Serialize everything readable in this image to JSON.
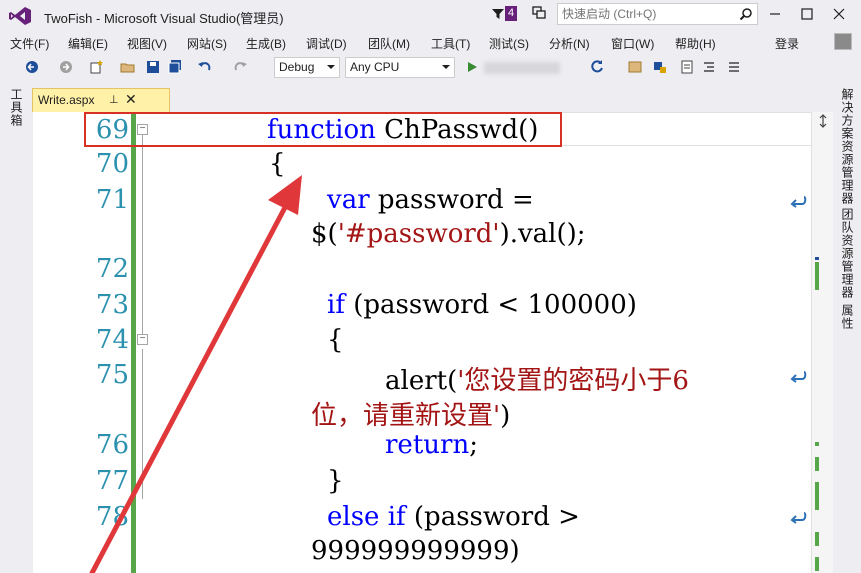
{
  "window": {
    "title": "TwoFish - Microsoft Visual Studio(管理员)",
    "notification_count": "4",
    "quick_launch_placeholder": "快速启动 (Ctrl+Q)"
  },
  "menu": {
    "items": [
      "文件(F)",
      "编辑(E)",
      "视图(V)",
      "网站(S)",
      "生成(B)",
      "调试(D)",
      "团队(M)",
      "工具(T)",
      "测试(S)",
      "分析(N)",
      "窗口(W)",
      "帮助(H)"
    ],
    "login_label": "登录"
  },
  "toolbar": {
    "configuration": "Debug",
    "platform": "Any CPU"
  },
  "left_rail": {
    "toolbox_label": "工具箱"
  },
  "right_rail": {
    "items": [
      "解决方案资源管理器",
      "团队资源管理器",
      "属性"
    ]
  },
  "tabs": [
    {
      "label": "Write.aspx",
      "pin": "⊥",
      "close": "✕"
    }
  ],
  "editor": {
    "line_numbers": [
      "69",
      "70",
      "71",
      "72",
      "73",
      "74",
      "75",
      "76",
      "77",
      "78"
    ],
    "code": {
      "l69_kw": "function",
      "l69_rest": " ChPasswd()",
      "l70": "{",
      "l71_kw": "var",
      "l71_rest": " password =",
      "l71b_pre": "$(",
      "l71b_str": "'#password'",
      "l71b_post": ").val();",
      "l73_kw": "if",
      "l73_rest": " (password < 100000)",
      "l74": "{",
      "l75_pre": "alert(",
      "l75_str": "'您设置的密码小于6",
      "l75b_str": "位，请重新设置'",
      "l75b_post": ")",
      "l76_kw": "return",
      "l76_rest": ";",
      "l77": "}",
      "l78_kw": "else if",
      "l78_rest": " (password >",
      "l78b": "999999999999)"
    }
  },
  "colors": {
    "keyword": "#0000ff",
    "string": "#a31515",
    "line_number": "#2b91af",
    "change_bar": "#57a64a",
    "annotation": "#d93025",
    "tab_active": "#fff1a8"
  }
}
